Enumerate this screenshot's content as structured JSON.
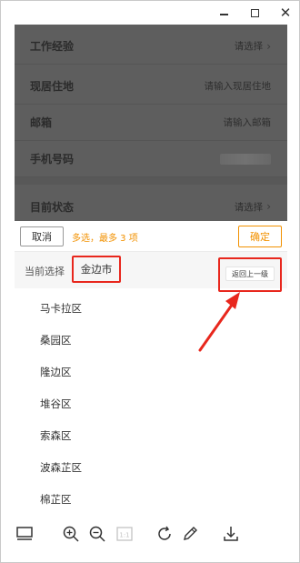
{
  "window": {
    "controls": {
      "minimize": "minimize-icon",
      "maximize": "maximize-icon",
      "close": "close-icon"
    }
  },
  "form": {
    "rows": [
      {
        "label": "工作经验",
        "value": "请选择",
        "chevron": true
      },
      {
        "label": "现居住地",
        "value": "请输入现居住地",
        "chevron": false
      },
      {
        "label": "邮箱",
        "value": "请输入邮箱",
        "chevron": false
      },
      {
        "label": "手机号码",
        "value": "",
        "blurred": true,
        "chevron": false
      },
      {
        "label": "目前状态",
        "value": "请选择",
        "chevron": true
      }
    ]
  },
  "picker": {
    "cancel_label": "取消",
    "hint": "多选，最多 3 项",
    "confirm_label": "确定",
    "current_label": "当前选择",
    "current_value": "金边市",
    "back_label": "返回上一级",
    "districts": [
      "马卡拉区",
      "桑园区",
      "隆边区",
      "堆谷区",
      "索森区",
      "波森芷区",
      "棉芷区"
    ]
  },
  "colors": {
    "accent": "#f29100",
    "highlight": "#e8271d",
    "overlay": "#5e5e5e"
  },
  "toolbar": {
    "icons": [
      "thumbnail-view-icon",
      "zoom-in-icon",
      "zoom-out-icon",
      "actual-size-icon",
      "rotate-icon",
      "edit-icon",
      "download-icon"
    ],
    "actual_size_label": "1:1"
  }
}
